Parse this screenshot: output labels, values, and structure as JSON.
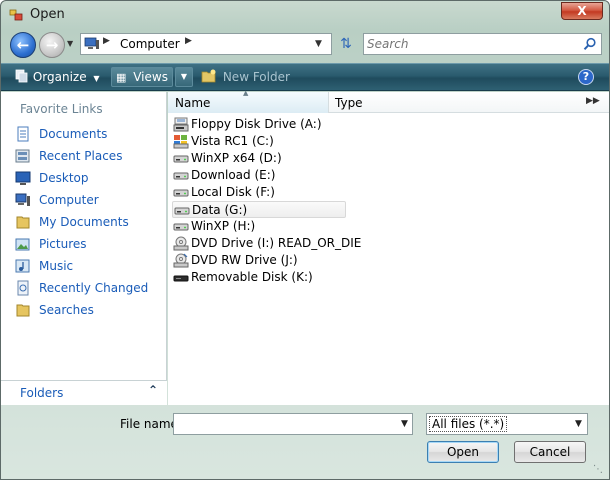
{
  "window": {
    "title": "Open",
    "close_label": "X"
  },
  "nav": {
    "address": {
      "segment": "Computer"
    },
    "search": {
      "placeholder": "Search"
    }
  },
  "toolbar": {
    "organize_label": "Organize",
    "views_label": "Views",
    "new_folder_label": "New Folder",
    "help_label": "?"
  },
  "favorites": {
    "title": "Favorite Links",
    "items": [
      {
        "label": "Documents",
        "icon": "documents-icon"
      },
      {
        "label": "Recent Places",
        "icon": "recent-places-icon"
      },
      {
        "label": "Desktop",
        "icon": "desktop-icon"
      },
      {
        "label": "Computer",
        "icon": "computer-icon"
      },
      {
        "label": "My Documents",
        "icon": "folder-icon"
      },
      {
        "label": "Pictures",
        "icon": "pictures-icon"
      },
      {
        "label": "Music",
        "icon": "music-icon"
      },
      {
        "label": "Recently Changed",
        "icon": "recently-changed-icon"
      },
      {
        "label": "Searches",
        "icon": "folder-icon"
      }
    ],
    "folders_label": "Folders"
  },
  "columns": {
    "name": "Name",
    "type": "Type"
  },
  "files": [
    {
      "label": "Floppy Disk Drive (A:)",
      "icon": "floppy-drive-icon"
    },
    {
      "label": "Vista RC1 (C:)",
      "icon": "system-drive-icon"
    },
    {
      "label": "WinXP x64 (D:)",
      "icon": "hard-drive-icon"
    },
    {
      "label": "Download (E:)",
      "icon": "hard-drive-icon"
    },
    {
      "label": "Local Disk (F:)",
      "icon": "hard-drive-icon"
    },
    {
      "label": "Data (G:)",
      "icon": "hard-drive-icon",
      "selected": true
    },
    {
      "label": "WinXP (H:)",
      "icon": "hard-drive-icon"
    },
    {
      "label": "DVD Drive (I:) READ_OR_DIE",
      "icon": "dvd-drive-icon"
    },
    {
      "label": "DVD RW Drive (J:)",
      "icon": "dvd-rw-drive-icon"
    },
    {
      "label": "Removable Disk (K:)",
      "icon": "removable-disk-icon"
    }
  ],
  "bottom": {
    "file_name_label": "File name:",
    "file_name_value": "",
    "filter_value": "All files (*.*)",
    "open_label": "Open",
    "cancel_label": "Cancel"
  }
}
